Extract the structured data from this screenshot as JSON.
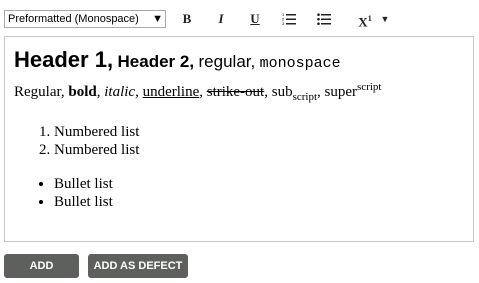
{
  "toolbar": {
    "format_select": "Preformatted (Monospace)",
    "bold_label": "B",
    "italic_label": "I",
    "underline_label": "U",
    "superscript_label": "X",
    "superscript_sup": "1",
    "icons": [
      "chevron-down-icon",
      "numbered-list-icon",
      "bullet-list-icon",
      "caret-down-icon"
    ]
  },
  "editor": {
    "header1": "Header 1,",
    "header2": "Header 2,",
    "regular_text": "regular,",
    "monospace_text": "monospace",
    "line2": {
      "regular": "Regular,",
      "bold": "bold",
      "italic": "italic",
      "underline": "underline",
      "strike": "strike-out",
      "sub_base": "sub",
      "sub": "script",
      "sup_base": "super",
      "sup": "script",
      "sep": ","
    },
    "numbered_list": [
      "Numbered list",
      "Numbered list"
    ],
    "bullet_list": [
      "Bullet list",
      "Bullet list"
    ]
  },
  "actions": {
    "add": "ADD",
    "add_defect": "ADD AS DEFECT"
  }
}
